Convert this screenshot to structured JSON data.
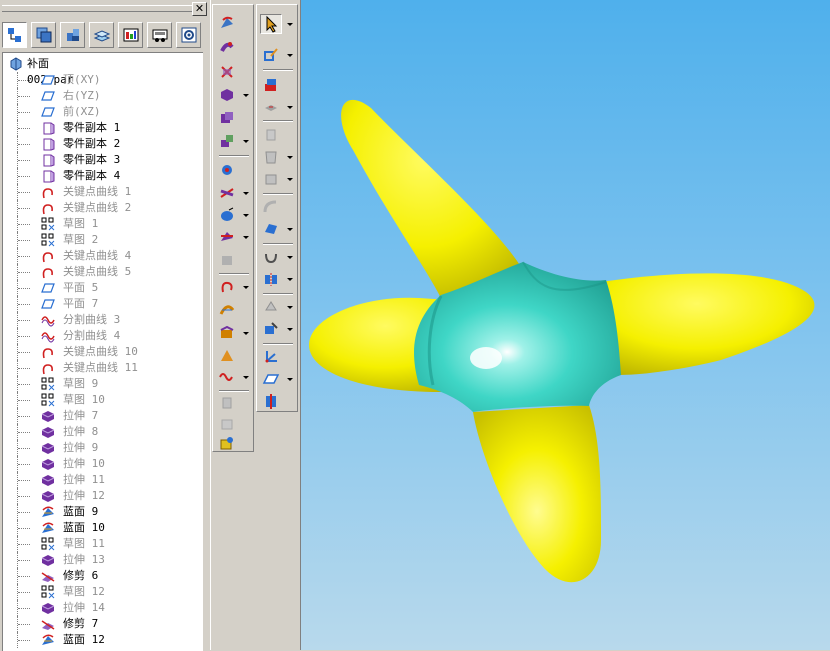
{
  "pane": {
    "close_label": "✕",
    "tabs": [
      {
        "name": "feature-tree-tab-icon"
      },
      {
        "name": "layers-tab-icon"
      },
      {
        "name": "parts-library-tab-icon"
      },
      {
        "name": "feature-library-tab-icon"
      },
      {
        "name": "family-of-parts-tab-icon"
      },
      {
        "name": "engineering-reference-tab-icon"
      },
      {
        "name": "settings-tab-icon"
      }
    ]
  },
  "tree": {
    "root": "补面002.par",
    "items": [
      {
        "label": "顶(XY)",
        "type": "plane",
        "active": false
      },
      {
        "label": "右(YZ)",
        "type": "plane",
        "active": false
      },
      {
        "label": "前(XZ)",
        "type": "plane",
        "active": false
      },
      {
        "label": "零件副本 1",
        "type": "part-copy",
        "active": true
      },
      {
        "label": "零件副本 2",
        "type": "part-copy",
        "active": true
      },
      {
        "label": "零件副本 3",
        "type": "part-copy",
        "active": true
      },
      {
        "label": "零件副本 4",
        "type": "part-copy",
        "active": true
      },
      {
        "label": "关键点曲线 1",
        "type": "keypoint-curve",
        "active": false
      },
      {
        "label": "关键点曲线 2",
        "type": "keypoint-curve",
        "active": false
      },
      {
        "label": "草图 1",
        "type": "sketch",
        "active": false
      },
      {
        "label": "草图 2",
        "type": "sketch",
        "active": false
      },
      {
        "label": "关键点曲线 4",
        "type": "keypoint-curve",
        "active": false
      },
      {
        "label": "关键点曲线 5",
        "type": "keypoint-curve",
        "active": false
      },
      {
        "label": "平面 5",
        "type": "plane",
        "active": false
      },
      {
        "label": "平面 7",
        "type": "plane",
        "active": false
      },
      {
        "label": "分割曲线 3",
        "type": "split-curve",
        "active": false
      },
      {
        "label": "分割曲线 4",
        "type": "split-curve",
        "active": false
      },
      {
        "label": "关键点曲线 10",
        "type": "keypoint-curve",
        "active": false
      },
      {
        "label": "关键点曲线 11",
        "type": "keypoint-curve",
        "active": false
      },
      {
        "label": "草图 9",
        "type": "sketch",
        "active": false
      },
      {
        "label": "草图 10",
        "type": "sketch",
        "active": false
      },
      {
        "label": "拉伸 7",
        "type": "extrude",
        "active": false
      },
      {
        "label": "拉伸 8",
        "type": "extrude",
        "active": false
      },
      {
        "label": "拉伸 9",
        "type": "extrude",
        "active": false
      },
      {
        "label": "拉伸 10",
        "type": "extrude",
        "active": false
      },
      {
        "label": "拉伸 11",
        "type": "extrude",
        "active": false
      },
      {
        "label": "拉伸 12",
        "type": "extrude",
        "active": false
      },
      {
        "label": "蓝面 9",
        "type": "bluesurf",
        "active": true
      },
      {
        "label": "蓝面 10",
        "type": "bluesurf",
        "active": true
      },
      {
        "label": "草图 11",
        "type": "sketch",
        "active": false
      },
      {
        "label": "拉伸 13",
        "type": "extrude",
        "active": false
      },
      {
        "label": "修剪 6",
        "type": "trim",
        "active": true
      },
      {
        "label": "草图 12",
        "type": "sketch",
        "active": false
      },
      {
        "label": "拉伸 14",
        "type": "extrude",
        "active": false
      },
      {
        "label": "修剪 7",
        "type": "trim",
        "active": true
      },
      {
        "label": "蓝面 12",
        "type": "bluesurf",
        "active": true
      }
    ]
  },
  "colors": {
    "blade": "#f5f000",
    "hub": "#3fd6c6",
    "sky_top": "#4fb0ec",
    "sky_bottom": "#b8d9ec"
  }
}
